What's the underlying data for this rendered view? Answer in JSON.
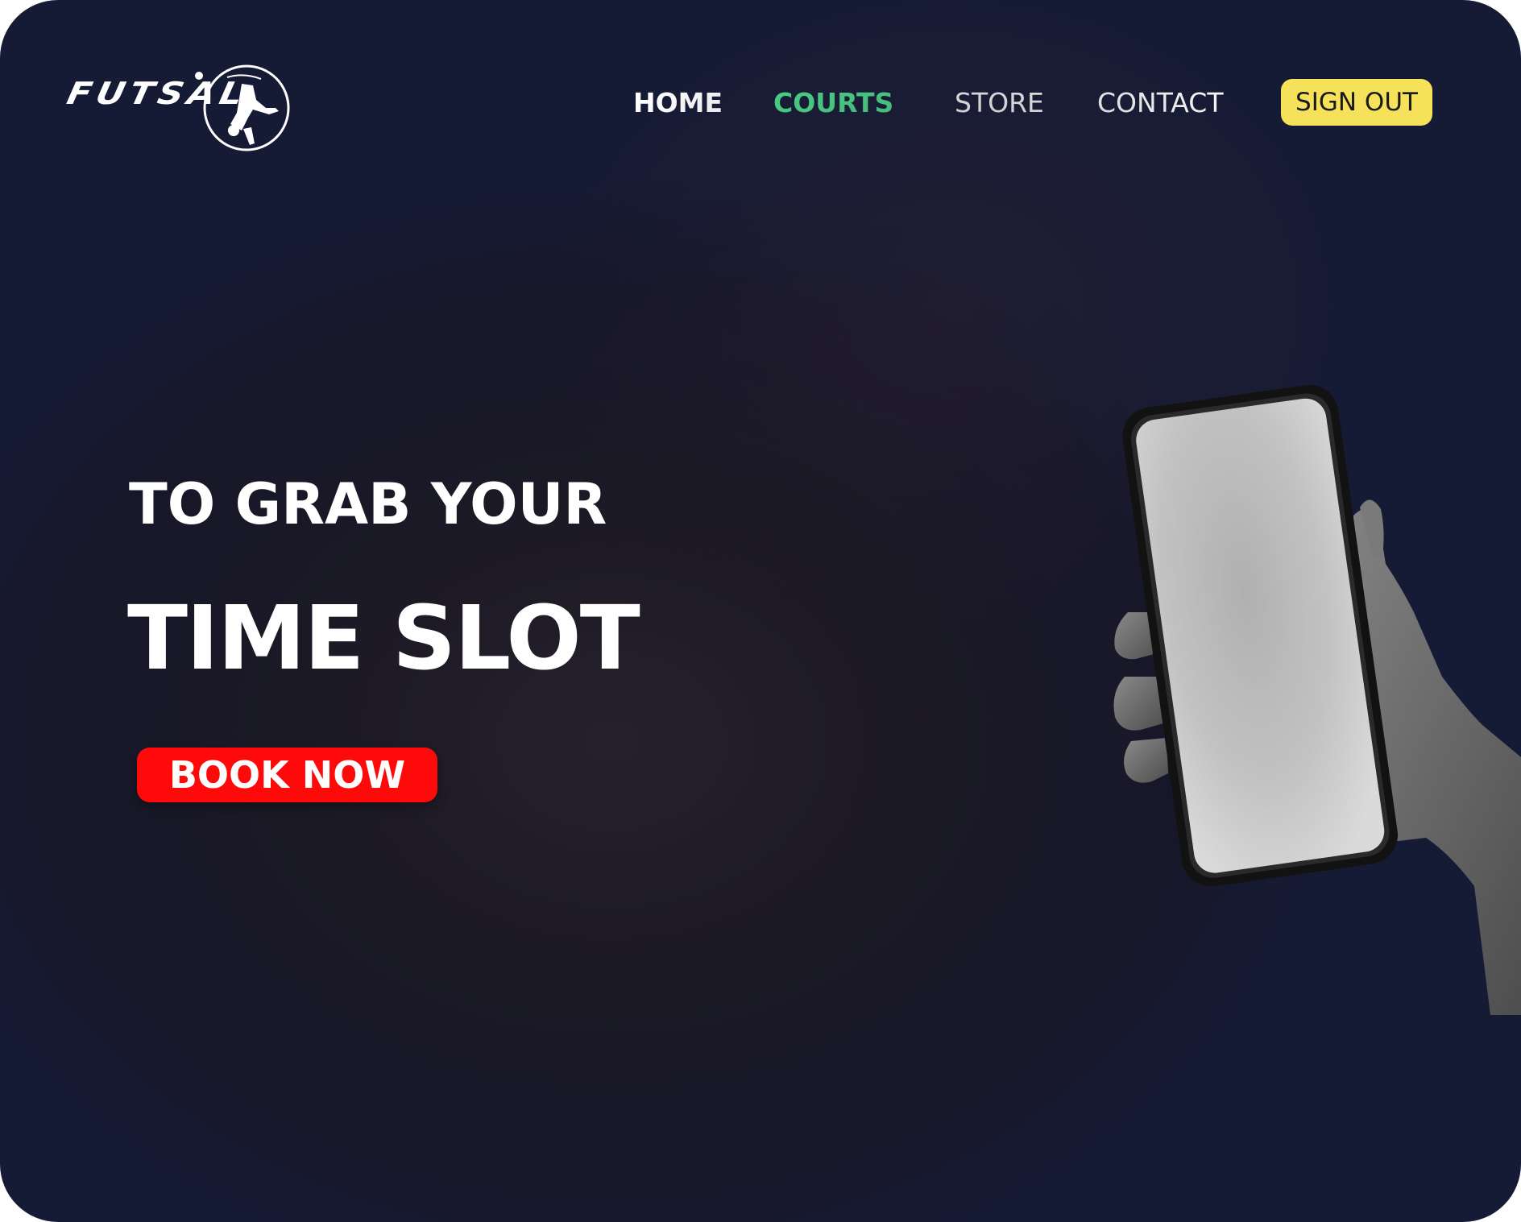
{
  "brand": {
    "logo_text": "FUTSAL",
    "logo_icon": "soccer-player-bicycle-kick-icon"
  },
  "nav": {
    "items": [
      {
        "label": "HOME",
        "color": "#ffffff",
        "state": "default"
      },
      {
        "label": "COURTS",
        "color": "#4ee38f",
        "state": "active"
      },
      {
        "label": "STORE",
        "color": "#ffffff",
        "state": "default"
      },
      {
        "label": "CONTACT",
        "color": "#ffffff",
        "state": "default"
      }
    ],
    "sign_out_label": "SIGN OUT",
    "sign_out_color": "#f5e25a"
  },
  "hero": {
    "line1": "TO GRAB YOUR",
    "line2": "TIME SLOT",
    "cta_label": "BOOK NOW",
    "cta_color": "#ff0a0a"
  },
  "illustration": {
    "icon": "hand-holding-phone-icon"
  },
  "colors": {
    "background": "#1b1925",
    "text": "#ffffff"
  }
}
